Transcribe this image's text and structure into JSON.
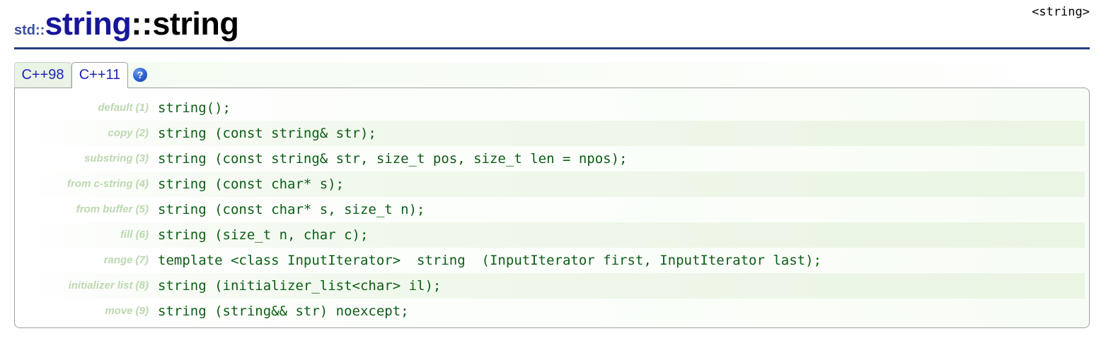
{
  "title": {
    "namespace": "std::",
    "class_name": "string",
    "separator": "::",
    "function_name": "string"
  },
  "header_ref": "<string>",
  "tabs": [
    {
      "label": "C++98",
      "selected": false
    },
    {
      "label": "C++11",
      "selected": true
    }
  ],
  "help_icon": {
    "glyph": "?",
    "icon": "help-icon"
  },
  "overloads": [
    {
      "label": "default (1)",
      "code": "string();"
    },
    {
      "label": "copy (2)",
      "code": "string (const string& str);"
    },
    {
      "label": "substring (3)",
      "code": "string (const string& str, size_t pos, size_t len = npos);"
    },
    {
      "label": "from c-string (4)",
      "code": "string (const char* s);"
    },
    {
      "label": "from buffer (5)",
      "code": "string (const char* s, size_t n);"
    },
    {
      "label": "fill (6)",
      "code": "string (size_t n, char c);"
    },
    {
      "label": "range (7)",
      "code": "template <class InputIterator>  string  (InputIterator first, InputIterator last);"
    },
    {
      "label": "initializer list (8)",
      "code": "string (initializer_list<char> il);"
    },
    {
      "label": "move (9)",
      "code": "string (string&& str) noexcept;"
    }
  ],
  "colors": {
    "class_name": "#17169a",
    "namespace": "#3a4e9c",
    "rule": "#2b3f7d",
    "tab_text": "#1d24b5",
    "code_text": "#0d5c16",
    "label_text": "#bcd8b0"
  }
}
